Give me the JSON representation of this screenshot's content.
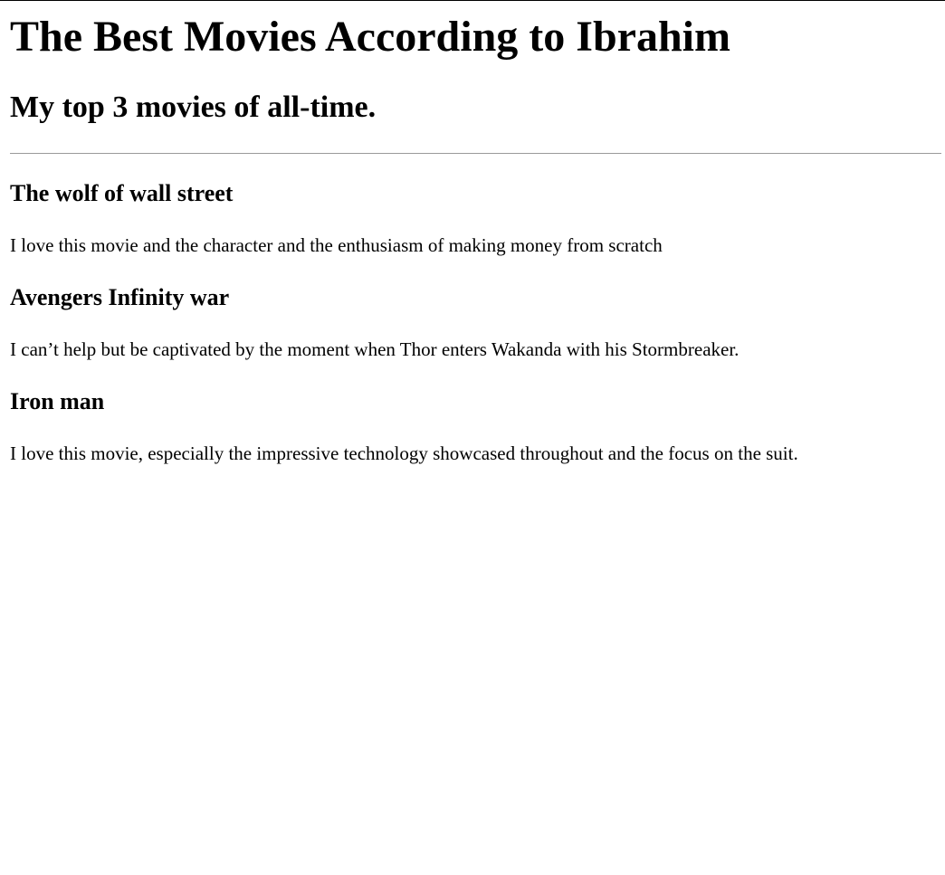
{
  "page": {
    "title": "The Best Movies According to Ibrahim",
    "subtitle": "My top 3 movies of all-time."
  },
  "movies": [
    {
      "title": "The wolf of wall street",
      "description": "I love this movie and the character and the enthusiasm of making money from scratch"
    },
    {
      "title": "Avengers Infinity war",
      "description": "I can’t help but be captivated by the moment when Thor enters Wakanda with his Stormbreaker."
    },
    {
      "title": "Iron man",
      "description": "I love this movie, especially the impressive technology showcased throughout and the focus on the suit."
    }
  ]
}
